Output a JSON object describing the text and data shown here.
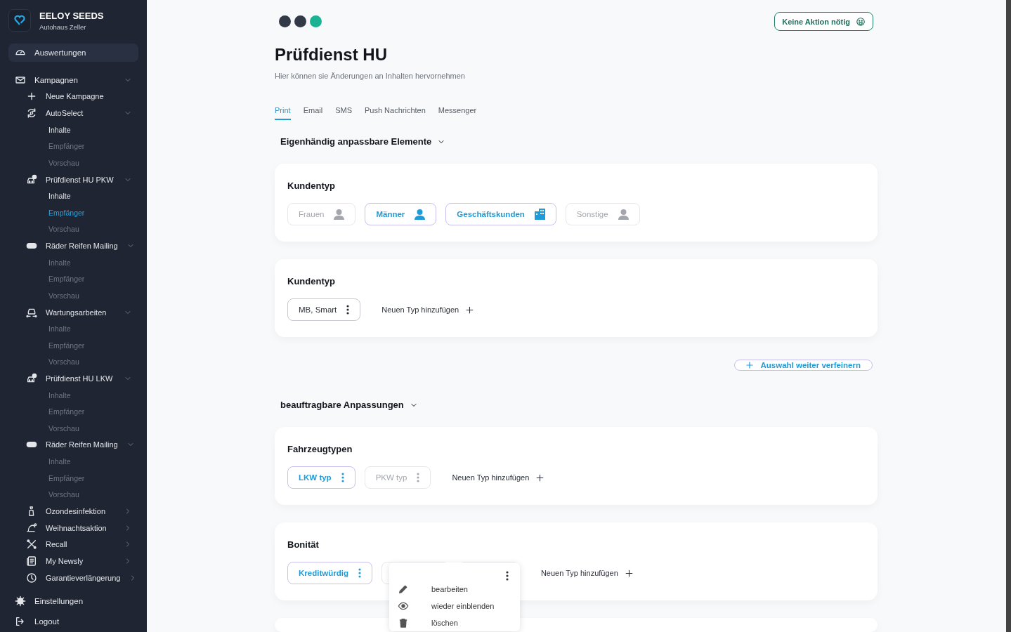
{
  "sidebar": {
    "brand": {
      "name": "EELOY SEEDS",
      "subtitle": "Autohaus Zeller"
    },
    "top": [
      {
        "label": "Auswertungen",
        "selected": true
      }
    ],
    "campaigns": {
      "label": "Kampagnen",
      "expanded": true,
      "children": [
        {
          "kind": "action",
          "label": "Neue Kampagne"
        },
        {
          "kind": "campaign",
          "label": "AutoSelect",
          "expanded": true,
          "children": [
            {
              "label": "Inhalte",
              "selected": false,
              "visited": true
            },
            {
              "label": "Empfänger",
              "selected": false,
              "visited": false
            },
            {
              "label": "Vorschau",
              "selected": false,
              "visited": false
            }
          ]
        },
        {
          "kind": "campaign",
          "label": "Prüfdienst HU PKW",
          "expanded": true,
          "children": [
            {
              "label": "Inhalte",
              "selected": false,
              "visited": true
            },
            {
              "label": "Empfänger",
              "selected": true,
              "visited": false
            },
            {
              "label": "Vorschau",
              "selected": false,
              "visited": false
            }
          ]
        },
        {
          "kind": "campaign",
          "label": "Räder Reifen Mailing",
          "expanded": true,
          "children": [
            {
              "label": "Inhalte",
              "selected": false,
              "visited": false
            },
            {
              "label": "Empfänger",
              "selected": false,
              "visited": false
            },
            {
              "label": "Vorschau",
              "selected": false,
              "visited": false
            }
          ]
        },
        {
          "kind": "campaign",
          "label": "Wartungsarbeiten",
          "expanded": true,
          "children": [
            {
              "label": "Inhalte",
              "selected": false,
              "visited": false
            },
            {
              "label": "Empfänger",
              "selected": false,
              "visited": false
            },
            {
              "label": "Vorschau",
              "selected": false,
              "visited": false
            }
          ]
        },
        {
          "kind": "campaign",
          "label": "Prüfdienst HU LKW",
          "expanded": true,
          "children": [
            {
              "label": "Inhalte",
              "selected": false,
              "visited": false
            },
            {
              "label": "Empfänger",
              "selected": false,
              "visited": false
            },
            {
              "label": "Vorschau",
              "selected": false,
              "visited": false
            }
          ]
        },
        {
          "kind": "campaign",
          "label": "Räder Reifen Mailing",
          "expanded": true,
          "children": [
            {
              "label": "Inhalte",
              "selected": false,
              "visited": false
            },
            {
              "label": "Empfänger",
              "selected": false,
              "visited": false
            },
            {
              "label": "Vorschau",
              "selected": false,
              "visited": false
            }
          ]
        },
        {
          "kind": "campaign",
          "label": "Ozondesinfektion",
          "expanded": false
        },
        {
          "kind": "campaign",
          "label": "Weihnachtsaktion",
          "expanded": false
        },
        {
          "kind": "campaign",
          "label": "Recall",
          "expanded": false
        },
        {
          "kind": "campaign",
          "label": "My Newsly",
          "expanded": false
        },
        {
          "kind": "campaign",
          "label": "Garantieverlängerung",
          "expanded": false
        }
      ]
    },
    "bottom": [
      {
        "label": "Einstellungen"
      },
      {
        "label": "Logout"
      }
    ]
  },
  "progress_steps": [
    {
      "selected": false
    },
    {
      "selected": false
    },
    {
      "selected": true
    }
  ],
  "status_button": {
    "label": "Keine Aktion nötig"
  },
  "title": "Prüfdienst HU",
  "subtitle": "Hier können sie Änderungen an Inhalten hervornehmen",
  "tabs": [
    {
      "label": "Print",
      "selected": true
    },
    {
      "label": "Email",
      "selected": false
    },
    {
      "label": "SMS",
      "selected": false
    },
    {
      "label": "Push Nachrichten",
      "selected": false
    },
    {
      "label": "Messenger",
      "selected": false
    }
  ],
  "sections": [
    {
      "title": "Eigenhändig anpassbare Elemente",
      "expanded": true,
      "cards": [
        {
          "title": "Kundentyp",
          "chips": [
            {
              "kind": "person",
              "label": "Frauen",
              "selected": false,
              "disabled": true
            },
            {
              "kind": "person",
              "label": "Männer",
              "selected": true,
              "disabled": false
            },
            {
              "kind": "company",
              "label": "Geschäftskunden",
              "selected": true,
              "disabled": false
            },
            {
              "kind": "person",
              "label": "Sonstige",
              "selected": false,
              "disabled": true
            }
          ]
        },
        {
          "title": "Kundentyp",
          "chips": [
            {
              "kind": "menu",
              "label": "MB, Smart",
              "selected": false,
              "disabled": false
            }
          ],
          "add_label": "Neuen Typ hinzufügen"
        }
      ],
      "action": {
        "label": "Auswahl weiter verfeinern"
      }
    },
    {
      "title": "beauftragbare Anpassungen",
      "expanded": true,
      "cards": [
        {
          "title": "Fahrzeugtypen",
          "chips": [
            {
              "kind": "menu",
              "label": "LKW typ",
              "selected": true,
              "disabled": false
            },
            {
              "kind": "menu",
              "label": "PKW typ",
              "selected": false,
              "disabled": true
            }
          ],
          "add_label": "Neuen Typ hinzufügen"
        },
        {
          "title": "Bonität",
          "chips": [
            {
              "kind": "menu",
              "label": "Kreditwürdig",
              "selected": true,
              "disabled": false
            },
            {
              "kind": "blank"
            },
            {
              "kind": "blank"
            }
          ],
          "add_label": "Neuen Typ hinzufügen",
          "popup_menu": {
            "items": [
              {
                "label": "bearbeiten"
              },
              {
                "label": "wieder einblenden"
              },
              {
                "label": "löschen"
              }
            ]
          }
        }
      ]
    }
  ]
}
